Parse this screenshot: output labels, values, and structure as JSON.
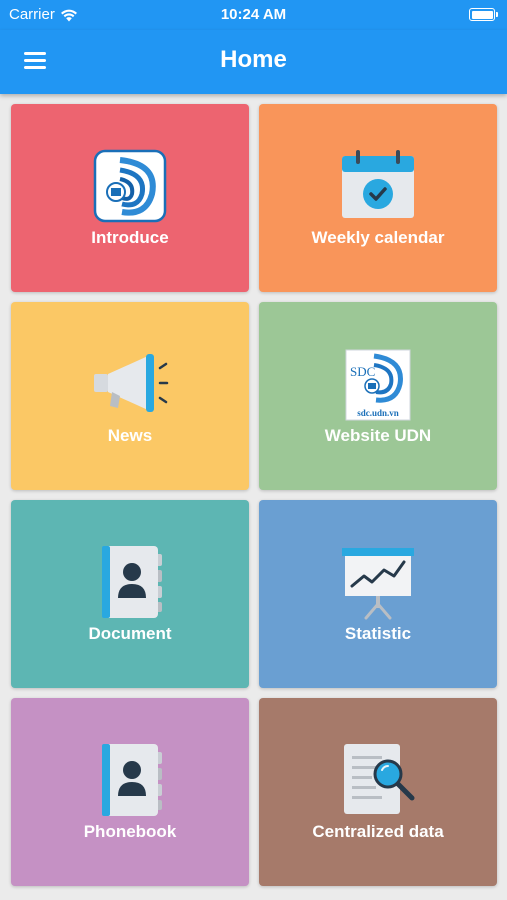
{
  "status_bar": {
    "carrier": "Carrier",
    "time": "10:24 AM",
    "wifi_icon": "wifi-icon",
    "battery_icon": "battery-icon"
  },
  "app_bar": {
    "title": "Home",
    "menu_icon": "hamburger-menu-icon",
    "color": "#2196f3"
  },
  "tiles": [
    {
      "label": "Introduce",
      "icon": "udn-logo-icon",
      "color": "#ed6470"
    },
    {
      "label": "Weekly calendar",
      "icon": "calendar-check-icon",
      "color": "#f9955a"
    },
    {
      "label": "News",
      "icon": "megaphone-icon",
      "color": "#fbc865"
    },
    {
      "label": "Website UDN",
      "icon": "sdc-udn-logo-icon",
      "color": "#9cc796",
      "logo_text": "SDC",
      "logo_url": "sdc.udn.vn"
    },
    {
      "label": "Document",
      "icon": "contact-book-icon",
      "color": "#5db6b3"
    },
    {
      "label": "Statistic",
      "icon": "presentation-chart-icon",
      "color": "#6a9fd2"
    },
    {
      "label": "Phonebook",
      "icon": "contact-book-icon",
      "color": "#c591c4"
    },
    {
      "label": "Centralized data",
      "icon": "document-search-icon",
      "color": "#a67a6a"
    }
  ]
}
